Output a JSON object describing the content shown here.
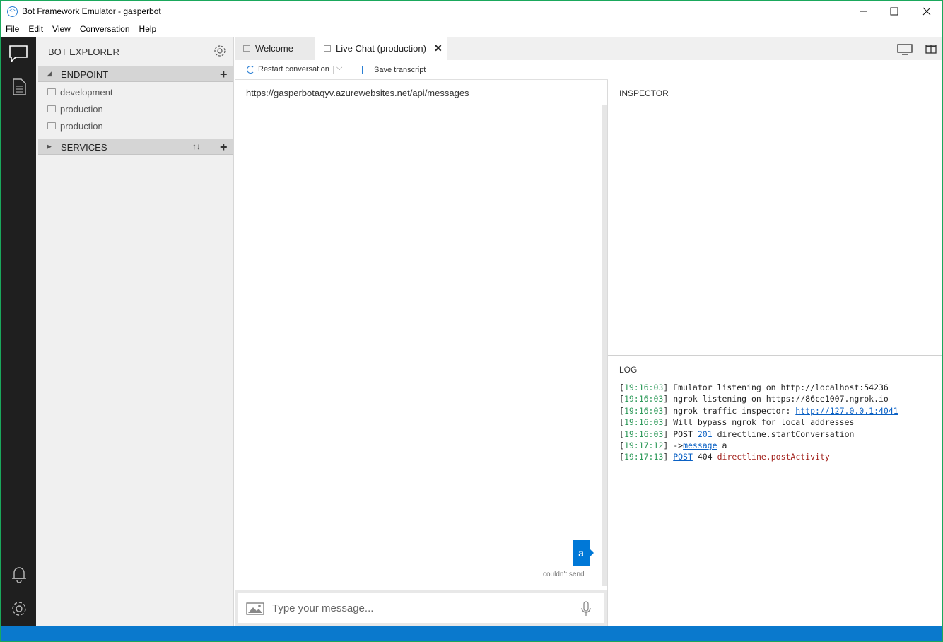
{
  "window": {
    "title": "Bot Framework Emulator - gasperbot",
    "app_icon_glyph": "<>"
  },
  "menu": [
    "File",
    "Edit",
    "View",
    "Conversation",
    "Help"
  ],
  "explorer": {
    "title": "BOT EXPLORER",
    "endpoint_section": "ENDPOINT",
    "endpoints": [
      "development",
      "production",
      "production"
    ],
    "services_section": "SERVICES"
  },
  "tabs": {
    "welcome": "Welcome",
    "live": "Live Chat (production)"
  },
  "toolbar": {
    "restart": "Restart conversation",
    "save": "Save transcript"
  },
  "chat": {
    "url": "https://gasperbotaqyv.azurewebsites.net/api/messages",
    "user_message": "a",
    "status": "couldn't send",
    "placeholder": "Type your message..."
  },
  "inspector": {
    "title": "INSPECTOR"
  },
  "log": {
    "title": "LOG",
    "entries": [
      {
        "time": "19:16:03",
        "text": "Emulator listening on http://localhost:54236"
      },
      {
        "time": "19:16:03",
        "text": "ngrok listening on https://86ce1007.ngrok.io"
      },
      {
        "time": "19:16:03",
        "pre": "ngrok traffic inspector: ",
        "link": "http://127.0.0.1:4041"
      },
      {
        "time": "19:16:03",
        "text": "Will bypass ngrok for local addresses"
      },
      {
        "time": "19:16:03",
        "method": "POST",
        "code": "201",
        "action": "directline.startConversation"
      },
      {
        "time": "19:17:12",
        "arrow": "->",
        "link": "message",
        "msg": "a"
      },
      {
        "time": "19:17:13",
        "method": "POST",
        "code": "404",
        "action": "directline.postActivity"
      }
    ]
  },
  "colors": {
    "accent": "#0078d7",
    "status_bar": "#0a79cd",
    "activity_bar": "#1f1f1f",
    "timestamp": "#2e9a5a",
    "error": "#a3241f"
  },
  "icons": {
    "activity": [
      "chat-icon",
      "document-icon",
      "bell-icon",
      "gear-icon"
    ]
  }
}
